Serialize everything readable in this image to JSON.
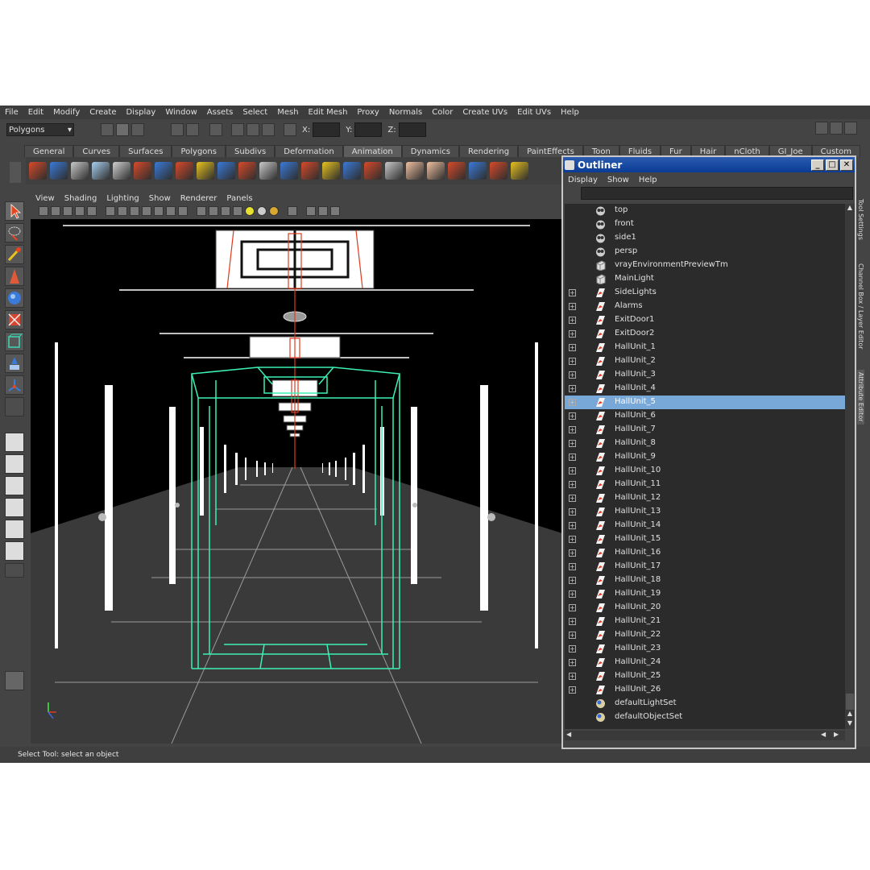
{
  "menubar": [
    "File",
    "Edit",
    "Modify",
    "Create",
    "Display",
    "Window",
    "Assets",
    "Select",
    "Mesh",
    "Edit Mesh",
    "Proxy",
    "Normals",
    "Color",
    "Create UVs",
    "Edit UVs",
    "Help"
  ],
  "status_line": {
    "mode": "Polygons",
    "x_label": "X:",
    "y_label": "Y:",
    "z_label": "Z:"
  },
  "shelf_tabs": [
    "General",
    "Curves",
    "Surfaces",
    "Polygons",
    "Subdivs",
    "Deformation",
    "Animation",
    "Dynamics",
    "Rendering",
    "PaintEffects",
    "Toon",
    "Fluids",
    "Fur",
    "Hair",
    "nCloth",
    "GI_Joe",
    "Custom"
  ],
  "active_shelf_tab": "Animation",
  "panel_menu": [
    "View",
    "Shading",
    "Lighting",
    "Show",
    "Renderer",
    "Panels"
  ],
  "status_bar": "Select Tool: select an object",
  "right_tabs": [
    "Tool Settings",
    "Channel Box / Layer Editor",
    "Attribute Editor"
  ],
  "outliner": {
    "title": "Outliner",
    "menu": [
      "Display",
      "Show",
      "Help"
    ],
    "selected": "HallUnit_5",
    "items": [
      {
        "label": "top",
        "icon": "camera-icon",
        "expandable": false
      },
      {
        "label": "front",
        "icon": "camera-icon",
        "expandable": false
      },
      {
        "label": "side1",
        "icon": "camera-icon",
        "expandable": false
      },
      {
        "label": "persp",
        "icon": "camera-icon",
        "expandable": false
      },
      {
        "label": "vrayEnvironmentPreviewTm",
        "icon": "transform-icon",
        "expandable": false
      },
      {
        "label": "MainLight",
        "icon": "transform-icon",
        "expandable": false
      },
      {
        "label": "SideLights",
        "icon": "group-icon",
        "expandable": true
      },
      {
        "label": "Alarms",
        "icon": "group-icon",
        "expandable": true
      },
      {
        "label": "ExitDoor1",
        "icon": "group-icon",
        "expandable": true
      },
      {
        "label": "ExitDoor2",
        "icon": "group-icon",
        "expandable": true
      },
      {
        "label": "HallUnit_1",
        "icon": "group-icon",
        "expandable": true
      },
      {
        "label": "HallUnit_2",
        "icon": "group-icon",
        "expandable": true
      },
      {
        "label": "HallUnit_3",
        "icon": "group-icon",
        "expandable": true
      },
      {
        "label": "HallUnit_4",
        "icon": "group-icon",
        "expandable": true
      },
      {
        "label": "HallUnit_5",
        "icon": "group-icon",
        "expandable": true
      },
      {
        "label": "HallUnit_6",
        "icon": "group-icon",
        "expandable": true
      },
      {
        "label": "HallUnit_7",
        "icon": "group-icon",
        "expandable": true
      },
      {
        "label": "HallUnit_8",
        "icon": "group-icon",
        "expandable": true
      },
      {
        "label": "HallUnit_9",
        "icon": "group-icon",
        "expandable": true
      },
      {
        "label": "HallUnit_10",
        "icon": "group-icon",
        "expandable": true
      },
      {
        "label": "HallUnit_11",
        "icon": "group-icon",
        "expandable": true
      },
      {
        "label": "HallUnit_12",
        "icon": "group-icon",
        "expandable": true
      },
      {
        "label": "HallUnit_13",
        "icon": "group-icon",
        "expandable": true
      },
      {
        "label": "HallUnit_14",
        "icon": "group-icon",
        "expandable": true
      },
      {
        "label": "HallUnit_15",
        "icon": "group-icon",
        "expandable": true
      },
      {
        "label": "HallUnit_16",
        "icon": "group-icon",
        "expandable": true
      },
      {
        "label": "HallUnit_17",
        "icon": "group-icon",
        "expandable": true
      },
      {
        "label": "HallUnit_18",
        "icon": "group-icon",
        "expandable": true
      },
      {
        "label": "HallUnit_19",
        "icon": "group-icon",
        "expandable": true
      },
      {
        "label": "HallUnit_20",
        "icon": "group-icon",
        "expandable": true
      },
      {
        "label": "HallUnit_21",
        "icon": "group-icon",
        "expandable": true
      },
      {
        "label": "HallUnit_22",
        "icon": "group-icon",
        "expandable": true
      },
      {
        "label": "HallUnit_23",
        "icon": "group-icon",
        "expandable": true
      },
      {
        "label": "HallUnit_24",
        "icon": "group-icon",
        "expandable": true
      },
      {
        "label": "HallUnit_25",
        "icon": "group-icon",
        "expandable": true
      },
      {
        "label": "HallUnit_26",
        "icon": "group-icon",
        "expandable": true
      },
      {
        "label": "defaultLightSet",
        "icon": "set-icon",
        "expandable": false
      },
      {
        "label": "defaultObjectSet",
        "icon": "set-icon",
        "expandable": false
      }
    ]
  },
  "colors": {
    "selection": "#78a8d8",
    "wireframe_selected": "#3cf0b4",
    "pivot_red": "#e03a1e",
    "title_bar": "#0a3c96"
  }
}
